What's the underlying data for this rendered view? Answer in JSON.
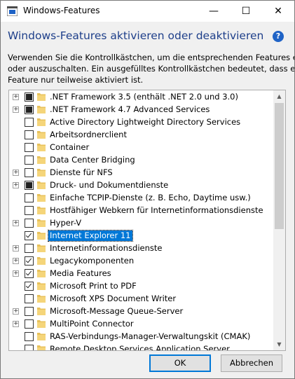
{
  "window": {
    "title": "Windows-Features",
    "controls": {
      "minimize": "—",
      "maximize": "☐",
      "close": "✕"
    }
  },
  "header": {
    "heading": "Windows-Features aktivieren oder deaktivieren",
    "help": "?",
    "description_lines": [
      "Verwenden Sie die Kontrollkästchen, um die entsprechenden Features ein-",
      "oder auszuschalten. Ein ausgefülltes Kontrollkästchen bedeutet, dass ein",
      "Feature nur teilweise aktiviert ist."
    ]
  },
  "features": [
    {
      "label": ".NET Framework 3.5 (enthält .NET 2.0 und 3.0)",
      "expandable": true,
      "state": "partial"
    },
    {
      "label": ".NET Framework 4.7 Advanced Services",
      "expandable": true,
      "state": "partial"
    },
    {
      "label": "Active Directory Lightweight Directory Services",
      "expandable": false,
      "state": "unchecked"
    },
    {
      "label": "Arbeitsordnerclient",
      "expandable": false,
      "state": "unchecked"
    },
    {
      "label": "Container",
      "expandable": false,
      "state": "unchecked"
    },
    {
      "label": "Data Center Bridging",
      "expandable": false,
      "state": "unchecked"
    },
    {
      "label": "Dienste für NFS",
      "expandable": true,
      "state": "unchecked"
    },
    {
      "label": "Druck- und Dokumentdienste",
      "expandable": true,
      "state": "partial"
    },
    {
      "label": "Einfache TCPIP-Dienste (z. B. Echo, Daytime usw.)",
      "expandable": false,
      "state": "unchecked"
    },
    {
      "label": "Hostfähiger Webkern für Internetinformationsdienste",
      "expandable": false,
      "state": "unchecked"
    },
    {
      "label": "Hyper-V",
      "expandable": true,
      "state": "unchecked"
    },
    {
      "label": "Internet Explorer 11",
      "expandable": false,
      "state": "checked",
      "selected": true
    },
    {
      "label": "Internetinformationsdienste",
      "expandable": true,
      "state": "unchecked"
    },
    {
      "label": "Legacykomponenten",
      "expandable": true,
      "state": "checked"
    },
    {
      "label": "Media Features",
      "expandable": true,
      "state": "checked"
    },
    {
      "label": "Microsoft Print to PDF",
      "expandable": false,
      "state": "checked"
    },
    {
      "label": "Microsoft XPS Document Writer",
      "expandable": false,
      "state": "unchecked"
    },
    {
      "label": "Microsoft-Message Queue-Server",
      "expandable": true,
      "state": "unchecked"
    },
    {
      "label": "MultiPoint Connector",
      "expandable": true,
      "state": "unchecked"
    },
    {
      "label": "RAS-Verbindungs-Manager-Verwaltungskit (CMAK)",
      "expandable": false,
      "state": "unchecked"
    },
    {
      "label": "Remote Desktop Services Application Server",
      "expandable": false,
      "state": "unchecked"
    }
  ],
  "expander_glyph": "+",
  "scrollbar": {
    "up": "▲",
    "down": "▼"
  },
  "buttons": {
    "ok": "OK",
    "cancel": "Abbrechen"
  },
  "colors": {
    "heading": "#1e3f8a",
    "selection": "#0078d7",
    "folder": "#e8c15a",
    "help": "#1f63c6"
  }
}
